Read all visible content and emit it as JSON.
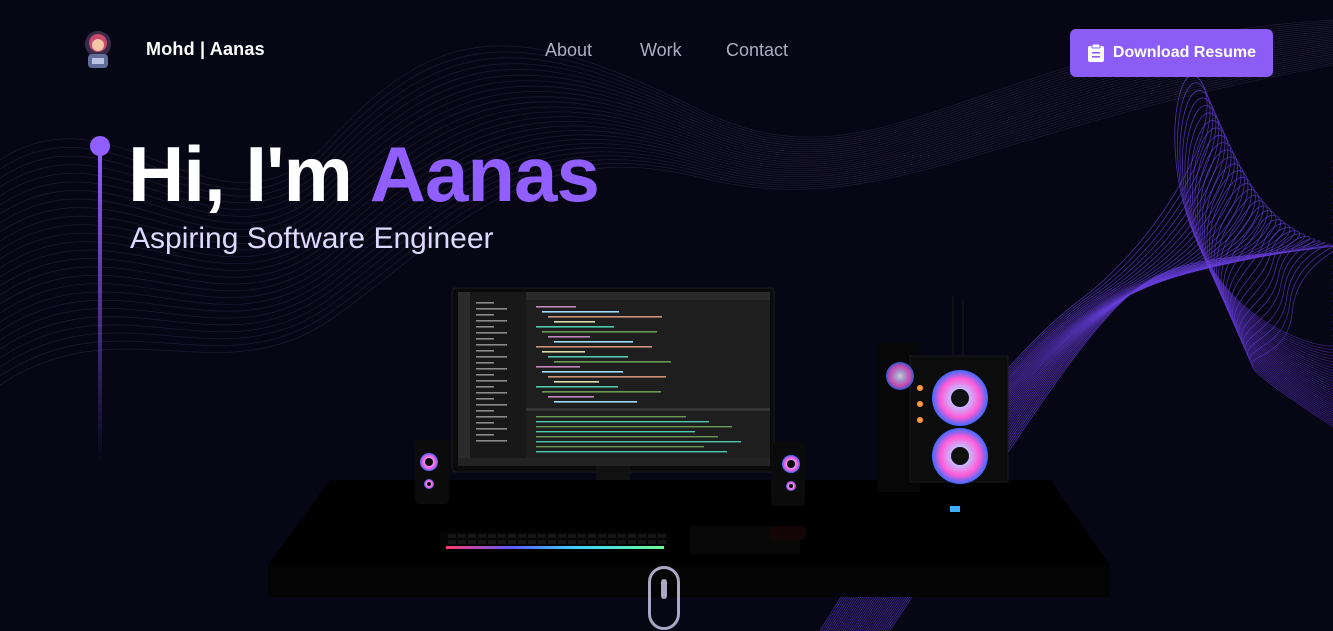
{
  "header": {
    "logo_icon": "avatar-logo-icon",
    "brand_first": "Mohd",
    "brand_sep": " |",
    "brand_last": "Aanas",
    "nav": [
      "About",
      "Work",
      "Contact"
    ],
    "resume_label": "Download Resume",
    "resume_icon": "clipboard-icon"
  },
  "hero": {
    "greeting": "Hi, I'm ",
    "name": "Aanas",
    "tagline": "Aspiring Software Engineer"
  },
  "colors": {
    "background": "#070615",
    "accent": "#915eff",
    "button": "#8b5cf6",
    "nav_text": "#aab0c0",
    "tagline": "#dfd9ff"
  },
  "scene": {
    "illustration": "desk-setup-with-monitor-pc-speakers-keyboard",
    "scroll_icon": "mouse-scroll-icon"
  }
}
